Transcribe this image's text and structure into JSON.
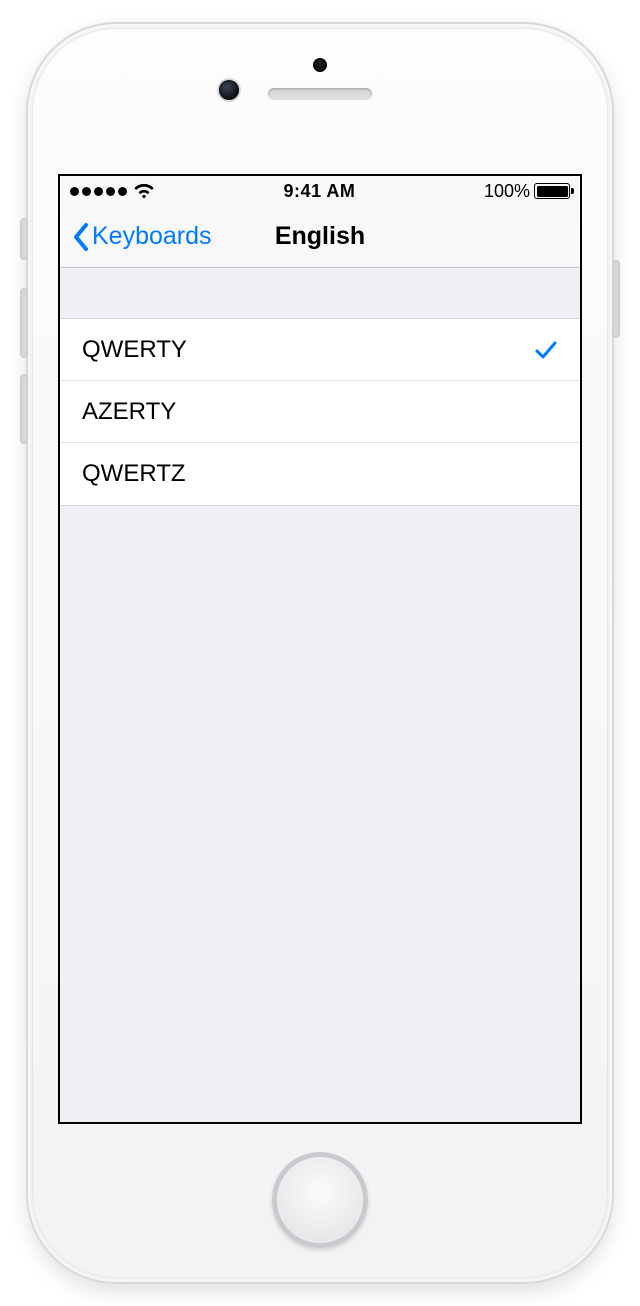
{
  "status": {
    "time": "9:41 AM",
    "battery_pct": "100%"
  },
  "nav": {
    "back_label": "Keyboards",
    "title": "English"
  },
  "layouts": [
    {
      "label": "QWERTY",
      "selected": true
    },
    {
      "label": "AZERTY",
      "selected": false
    },
    {
      "label": "QWERTZ",
      "selected": false
    }
  ]
}
